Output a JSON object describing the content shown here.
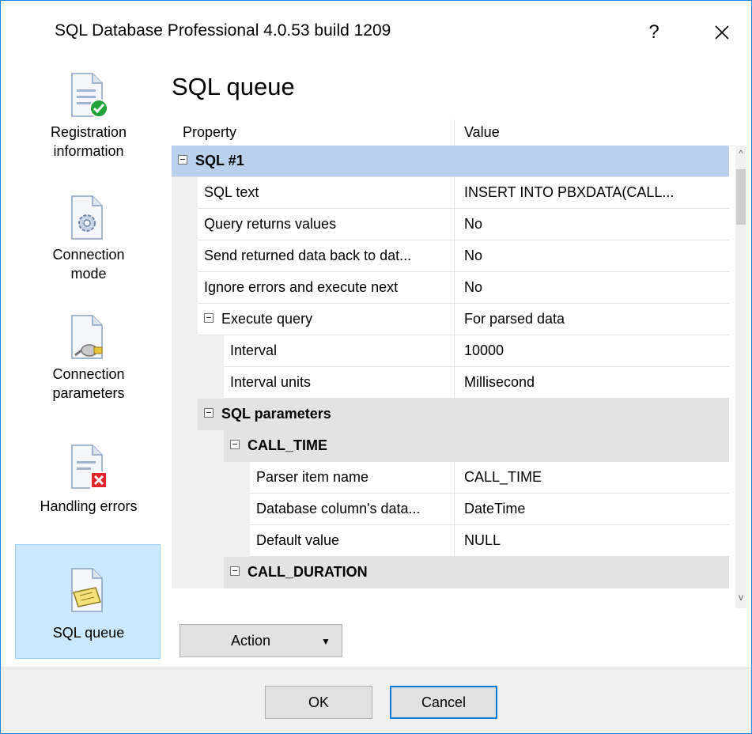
{
  "window": {
    "title": "SQL Database Professional 4.0.53 build 1209",
    "help_label": "?",
    "close_label": "✕"
  },
  "sidebar": {
    "items": [
      {
        "label_line1": "Registration",
        "label_line2": "information",
        "icon": "document-check-icon",
        "selected": false
      },
      {
        "label_line1": "Connection",
        "label_line2": "mode",
        "icon": "document-gear-icon",
        "selected": false
      },
      {
        "label_line1": "Connection",
        "label_line2": "parameters",
        "icon": "document-plug-icon",
        "selected": false
      },
      {
        "label_line1": "Handling errors",
        "label_line2": "",
        "icon": "document-error-icon",
        "selected": false
      },
      {
        "label_line1": "SQL queue",
        "label_line2": "",
        "icon": "document-note-icon",
        "selected": true
      }
    ]
  },
  "main": {
    "title": "SQL queue",
    "grid": {
      "columns": {
        "property": "Property",
        "value": "Value"
      },
      "rows": [
        {
          "property": "SQL #1",
          "value": "",
          "kind": "category-top",
          "level": 0
        },
        {
          "property": "SQL text",
          "value": "INSERT INTO PBXDATA(CALL...",
          "kind": "item",
          "level": 1
        },
        {
          "property": "Query returns values",
          "value": "No",
          "kind": "item",
          "level": 1
        },
        {
          "property": "Send returned data back to dat...",
          "value": "No",
          "kind": "item",
          "level": 1
        },
        {
          "property": "Ignore errors and execute next",
          "value": "No",
          "kind": "item",
          "level": 1
        },
        {
          "property": "Execute query",
          "value": "For parsed data",
          "kind": "expandable",
          "level": 1
        },
        {
          "property": "Interval",
          "value": "10000",
          "kind": "item",
          "level": 2
        },
        {
          "property": "Interval units",
          "value": "Millisecond",
          "kind": "item",
          "level": 2
        },
        {
          "property": "SQL parameters",
          "value": "",
          "kind": "category",
          "level": 1
        },
        {
          "property": "CALL_TIME",
          "value": "",
          "kind": "category",
          "level": 2
        },
        {
          "property": "Parser item name",
          "value": "CALL_TIME",
          "kind": "item",
          "level": 3
        },
        {
          "property": "Database column's data...",
          "value": "DateTime",
          "kind": "item",
          "level": 3
        },
        {
          "property": "Default value",
          "value": "NULL",
          "kind": "item",
          "level": 3
        },
        {
          "property": "CALL_DURATION",
          "value": "",
          "kind": "category",
          "level": 2
        }
      ]
    },
    "action_button": {
      "label": "Action",
      "arrow": "▼"
    },
    "scroll": {
      "up": "^",
      "down": "v"
    }
  },
  "footer": {
    "ok_label": "OK",
    "cancel_label": "Cancel"
  },
  "colors": {
    "selected_nav": "#cce8ff",
    "category_top": "#b9d1ea",
    "category": "#e3e3e3",
    "default_button_border": "#0078d7"
  }
}
